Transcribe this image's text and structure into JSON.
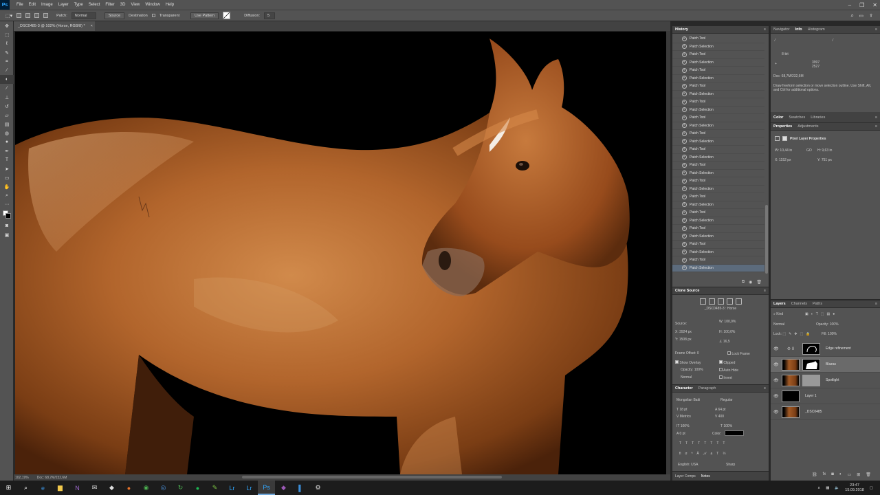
{
  "app": {
    "menu": [
      "File",
      "Edit",
      "Image",
      "Layer",
      "Type",
      "Select",
      "Filter",
      "3D",
      "View",
      "Window",
      "Help"
    ]
  },
  "options_bar": {
    "patch_label": "Patch:",
    "patch_mode": "Normal",
    "source": "Source",
    "destination": "Destination",
    "transparent": "Transparent",
    "use_pattern": "Use Pattern",
    "diffusion_label": "Diffusion:",
    "diffusion_value": "5"
  },
  "document": {
    "tab_title": "_DSC0485-3 @ 102% (Horse, RGB/8) *",
    "status_zoom": "102,19%",
    "status_doc": "Doc: 68,7M/232,6M"
  },
  "history": {
    "title": "History",
    "items": [
      "Patch Tool",
      "Patch Selection",
      "Patch Tool",
      "Patch Selection",
      "Patch Tool",
      "Patch Selection",
      "Patch Tool",
      "Patch Selection",
      "Patch Tool",
      "Patch Selection",
      "Patch Tool",
      "Patch Selection",
      "Patch Tool",
      "Patch Selection",
      "Patch Tool",
      "Patch Selection",
      "Patch Tool",
      "Patch Selection",
      "Patch Tool",
      "Patch Selection",
      "Patch Tool",
      "Patch Selection",
      "Patch Tool",
      "Patch Selection",
      "Patch Tool",
      "Patch Selection",
      "Patch Tool",
      "Patch Selection",
      "Patch Tool",
      "Patch Selection"
    ]
  },
  "clone_source": {
    "title": "Clone Source",
    "file": "_DSC0485-3 : Horse",
    "source_label": "Source:",
    "x": "3924 px",
    "y": "1508 px",
    "w": "100,0%",
    "h": "100,0%",
    "angle": "16,5",
    "frame_offset_label": "Frame Offset:",
    "frame_offset": "0",
    "lock_frame": "Lock Frame",
    "show_overlay": "Show Overlay",
    "clipped": "Clipped",
    "opacity_label": "Opacity:",
    "opacity": "100%",
    "auto_hide": "Auto Hide",
    "blend": "Normal",
    "invert": "Invert"
  },
  "character": {
    "tabs": [
      "Character",
      "Paragraph"
    ],
    "font": "Mongolian Baiti",
    "style": "Regular",
    "size": "18 pt",
    "leading": "64 pt",
    "kerning": "Metrics",
    "tracking": "400",
    "vscale": "100%",
    "hscale": "100%",
    "baseline": "0 pt",
    "color_label": "Color:",
    "language": "English: USA",
    "antialias": "Sharp"
  },
  "bottom_tabs": [
    "Layer Comps",
    "Notes"
  ],
  "navigator": {
    "tabs": [
      "Navigator",
      "Info",
      "Histogram"
    ],
    "doc": "Doc: 68,7M/232,6M",
    "hint": "Draw freeform selection or move selection outline. Use Shift, Alt, and Ctrl for additional options.",
    "x": "3997",
    "y": "2527",
    "bit": "8-bit"
  },
  "color_tabs": [
    "Color",
    "Swatches",
    "Libraries"
  ],
  "properties": {
    "tabs": [
      "Properties",
      "Adjustments"
    ],
    "title": "Pixel Layer Properties",
    "w": "10,44 in",
    "h": "9,63 in",
    "x": "1152 px",
    "y": "751 px",
    "go": "GO"
  },
  "layers": {
    "tabs": [
      "Layers",
      "Channels",
      "Paths"
    ],
    "kind": "Kind",
    "blend": "Normal",
    "opacity_label": "Opacity:",
    "opacity": "100%",
    "lock_label": "Lock:",
    "fill_label": "Fill:",
    "fill": "100%",
    "items": [
      {
        "name": "Edge refinement"
      },
      {
        "name": "Blazas"
      },
      {
        "name": "Spotlight"
      },
      {
        "name": "Layer 1"
      },
      {
        "name": "_DSC0485"
      }
    ]
  },
  "taskbar": {
    "time": "23:47",
    "date": "15.09.2018"
  }
}
